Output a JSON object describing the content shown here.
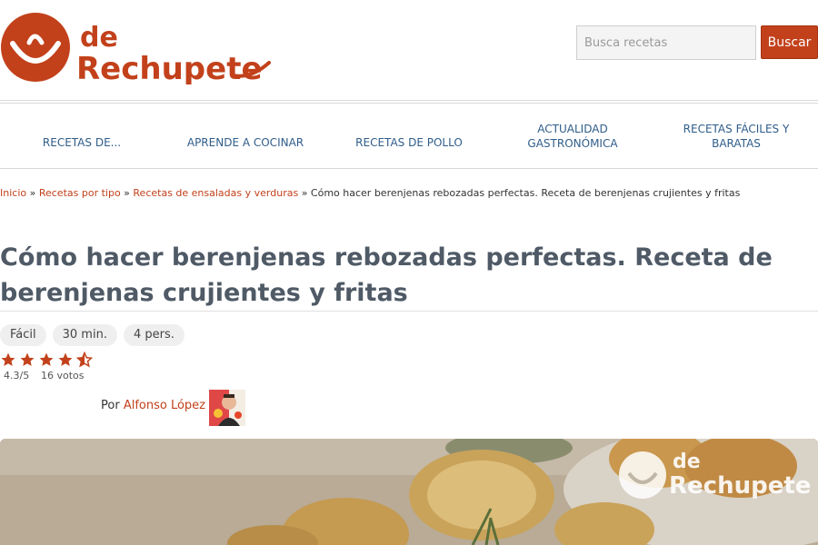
{
  "header": {
    "logo_text_top": "de",
    "logo_text_bottom": "Rechupete",
    "search_placeholder": "Busca recetas",
    "search_button": "Buscar",
    "brand_color": "#c2411b"
  },
  "nav": {
    "items": [
      {
        "label": "RECETAS DE..."
      },
      {
        "label": "APRENDE A COCINAR"
      },
      {
        "label": "RECETAS DE POLLO"
      },
      {
        "label": "ACTUALIDAD GASTRONÓMICA"
      },
      {
        "label": "RECETAS FÁCILES Y BARATAS"
      }
    ],
    "link_color": "#2f5d8a"
  },
  "breadcrumb": {
    "items": [
      "Inicio",
      "Recetas por tipo",
      "Recetas de ensaladas y verduras"
    ],
    "separator": "»",
    "current": "Cómo hacer berenjenas rebozadas perfectas. Receta de berenjenas crujientes y fritas"
  },
  "recipe": {
    "title": "Cómo hacer berenjenas rebozadas perfectas. Receta de berenjenas crujientes y fritas",
    "difficulty": "Fácil",
    "time": "30 min.",
    "servings": "4 pers.",
    "rating_text": "4.3/5",
    "rating_value": 4.3,
    "rating_max": 5,
    "votes": "16 votos",
    "author_prefix": "Por",
    "author_name": "Alfonso López"
  },
  "hero": {
    "watermark_top": "de",
    "watermark_bottom": "Rechupete"
  },
  "icons": {
    "star": "star-icon",
    "half_star": "star-half-icon",
    "logo_mark": "smiley-face-icon"
  }
}
